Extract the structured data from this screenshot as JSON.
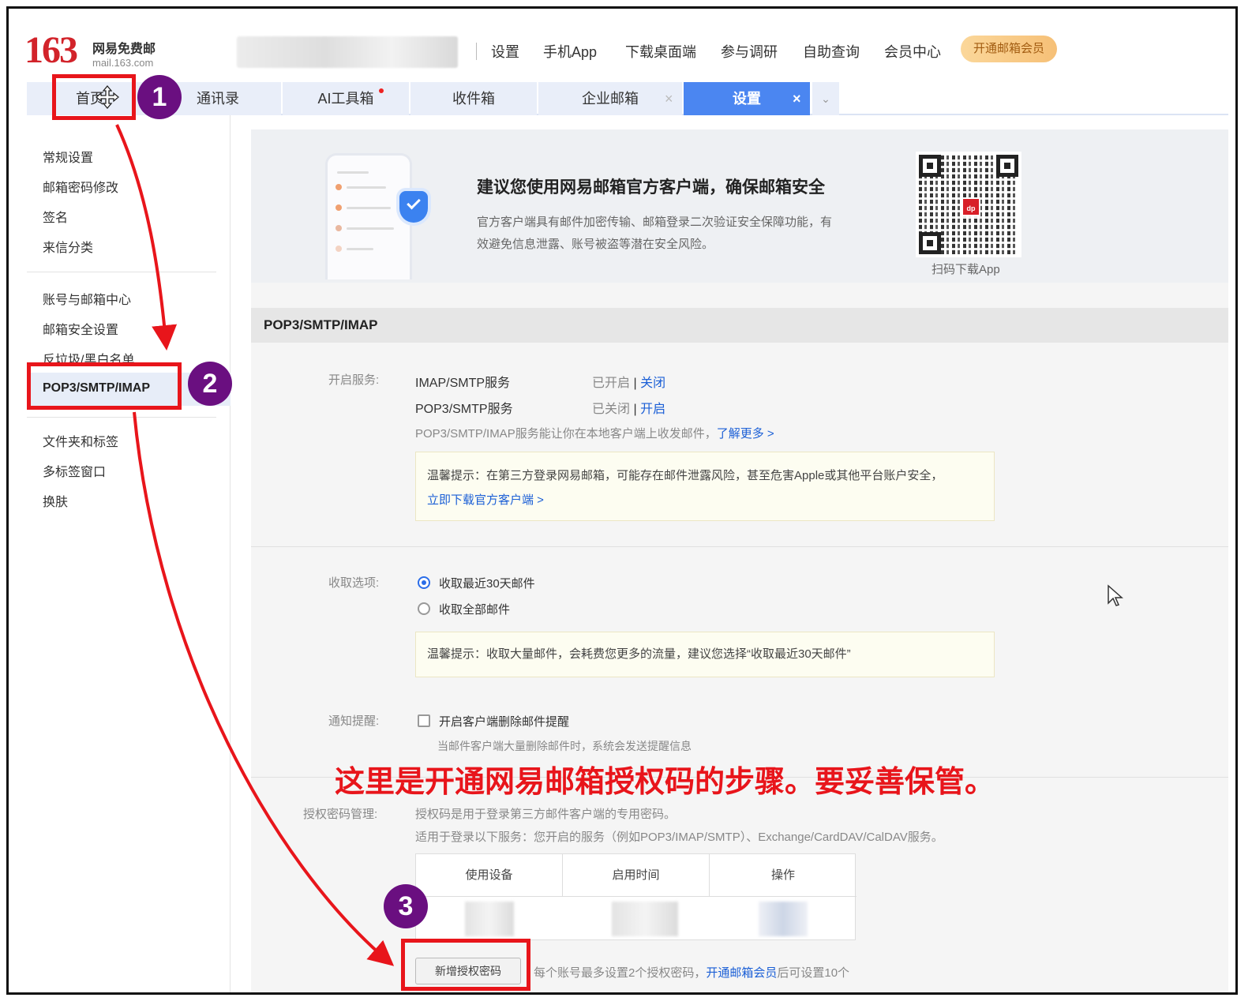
{
  "header": {
    "logo_number": "163",
    "logo_name": "网易免费邮",
    "logo_domain": "mail.163.com",
    "topnav": [
      "设置",
      "手机App",
      "下载桌面端",
      "参与调研",
      "自助查询",
      "会员中心"
    ],
    "vip_button": "开通邮箱会员"
  },
  "tabs": [
    {
      "label": "首页"
    },
    {
      "label": "通讯录"
    },
    {
      "label": "AI工具箱"
    },
    {
      "label": "收件箱"
    },
    {
      "label": "企业邮箱"
    },
    {
      "label": "设置"
    }
  ],
  "tab_close": "×",
  "sidebar": {
    "group1": [
      "常规设置",
      "邮箱密码修改",
      "签名",
      "来信分类"
    ],
    "group2": [
      "账号与邮箱中心",
      "邮箱安全设置",
      "反垃圾/黑白名单"
    ],
    "active": "POP3/SMTP/IMAP",
    "group3": [
      "文件夹和标签",
      "多标签窗口",
      "换肤"
    ]
  },
  "banner": {
    "title": "建议您使用网易邮箱官方客户端，确保邮箱安全",
    "desc": "官方客户端具有邮件加密传输、邮箱登录二次验证安全保障功能，有效避免信息泄露、账号被盗等潜在安全风险。",
    "qr_logo": "dp",
    "qr_caption": "扫码下载App"
  },
  "section_title": "POP3/SMTP/IMAP",
  "services": {
    "label": "开启服务:",
    "rows": [
      {
        "name": "IMAP/SMTP服务",
        "status": "已开启",
        "sep": " | ",
        "action": "关闭"
      },
      {
        "name": "POP3/SMTP服务",
        "status": "已关闭",
        "sep": " | ",
        "action": "开启"
      }
    ],
    "desc": "POP3/SMTP/IMAP服务能让你在本地客户端上收发邮件，",
    "learn_more": "了解更多 >",
    "notice": "温馨提示：在第三方登录网易邮箱，可能存在邮件泄露风险，甚至危害Apple或其他平台账户安全，",
    "notice_link": "立即下载官方客户端 >"
  },
  "receive": {
    "label": "收取选项:",
    "options": [
      {
        "label": "收取最近30天邮件",
        "selected": true
      },
      {
        "label": "收取全部邮件",
        "selected": false
      }
    ],
    "notice": "温馨提示：收取大量邮件，会耗费您更多的流量，建议您选择“收取最近30天邮件”"
  },
  "notify": {
    "label": "通知提醒:",
    "checkbox_label": "开启客户端删除邮件提醒",
    "checked": false,
    "desc": "当邮件客户端大量删除邮件时，系统会发送提醒信息"
  },
  "annotation_text": "这里是开通网易邮箱授权码的步骤。要妥善保管。",
  "auth": {
    "label": "授权密码管理:",
    "line1": "授权码是用于登录第三方邮件客户端的专用密码。",
    "line2": "适用于登录以下服务：您开启的服务（例如POP3/IMAP/SMTP）、Exchange/CardDAV/CalDAV服务。",
    "columns": [
      "使用设备",
      "启用时间",
      "操作"
    ],
    "add_button": "新增授权密码",
    "limit_text": "每个账号最多设置2个授权密码，",
    "limit_link": "开通邮箱会员",
    "limit_tail": "后可设置10个"
  },
  "badges": [
    "1",
    "2",
    "3"
  ],
  "colors": {
    "accent": "#4b86f1",
    "annotation_red": "#e8151b",
    "badge_purple": "#6a0f80",
    "link": "#1b5fd6"
  }
}
